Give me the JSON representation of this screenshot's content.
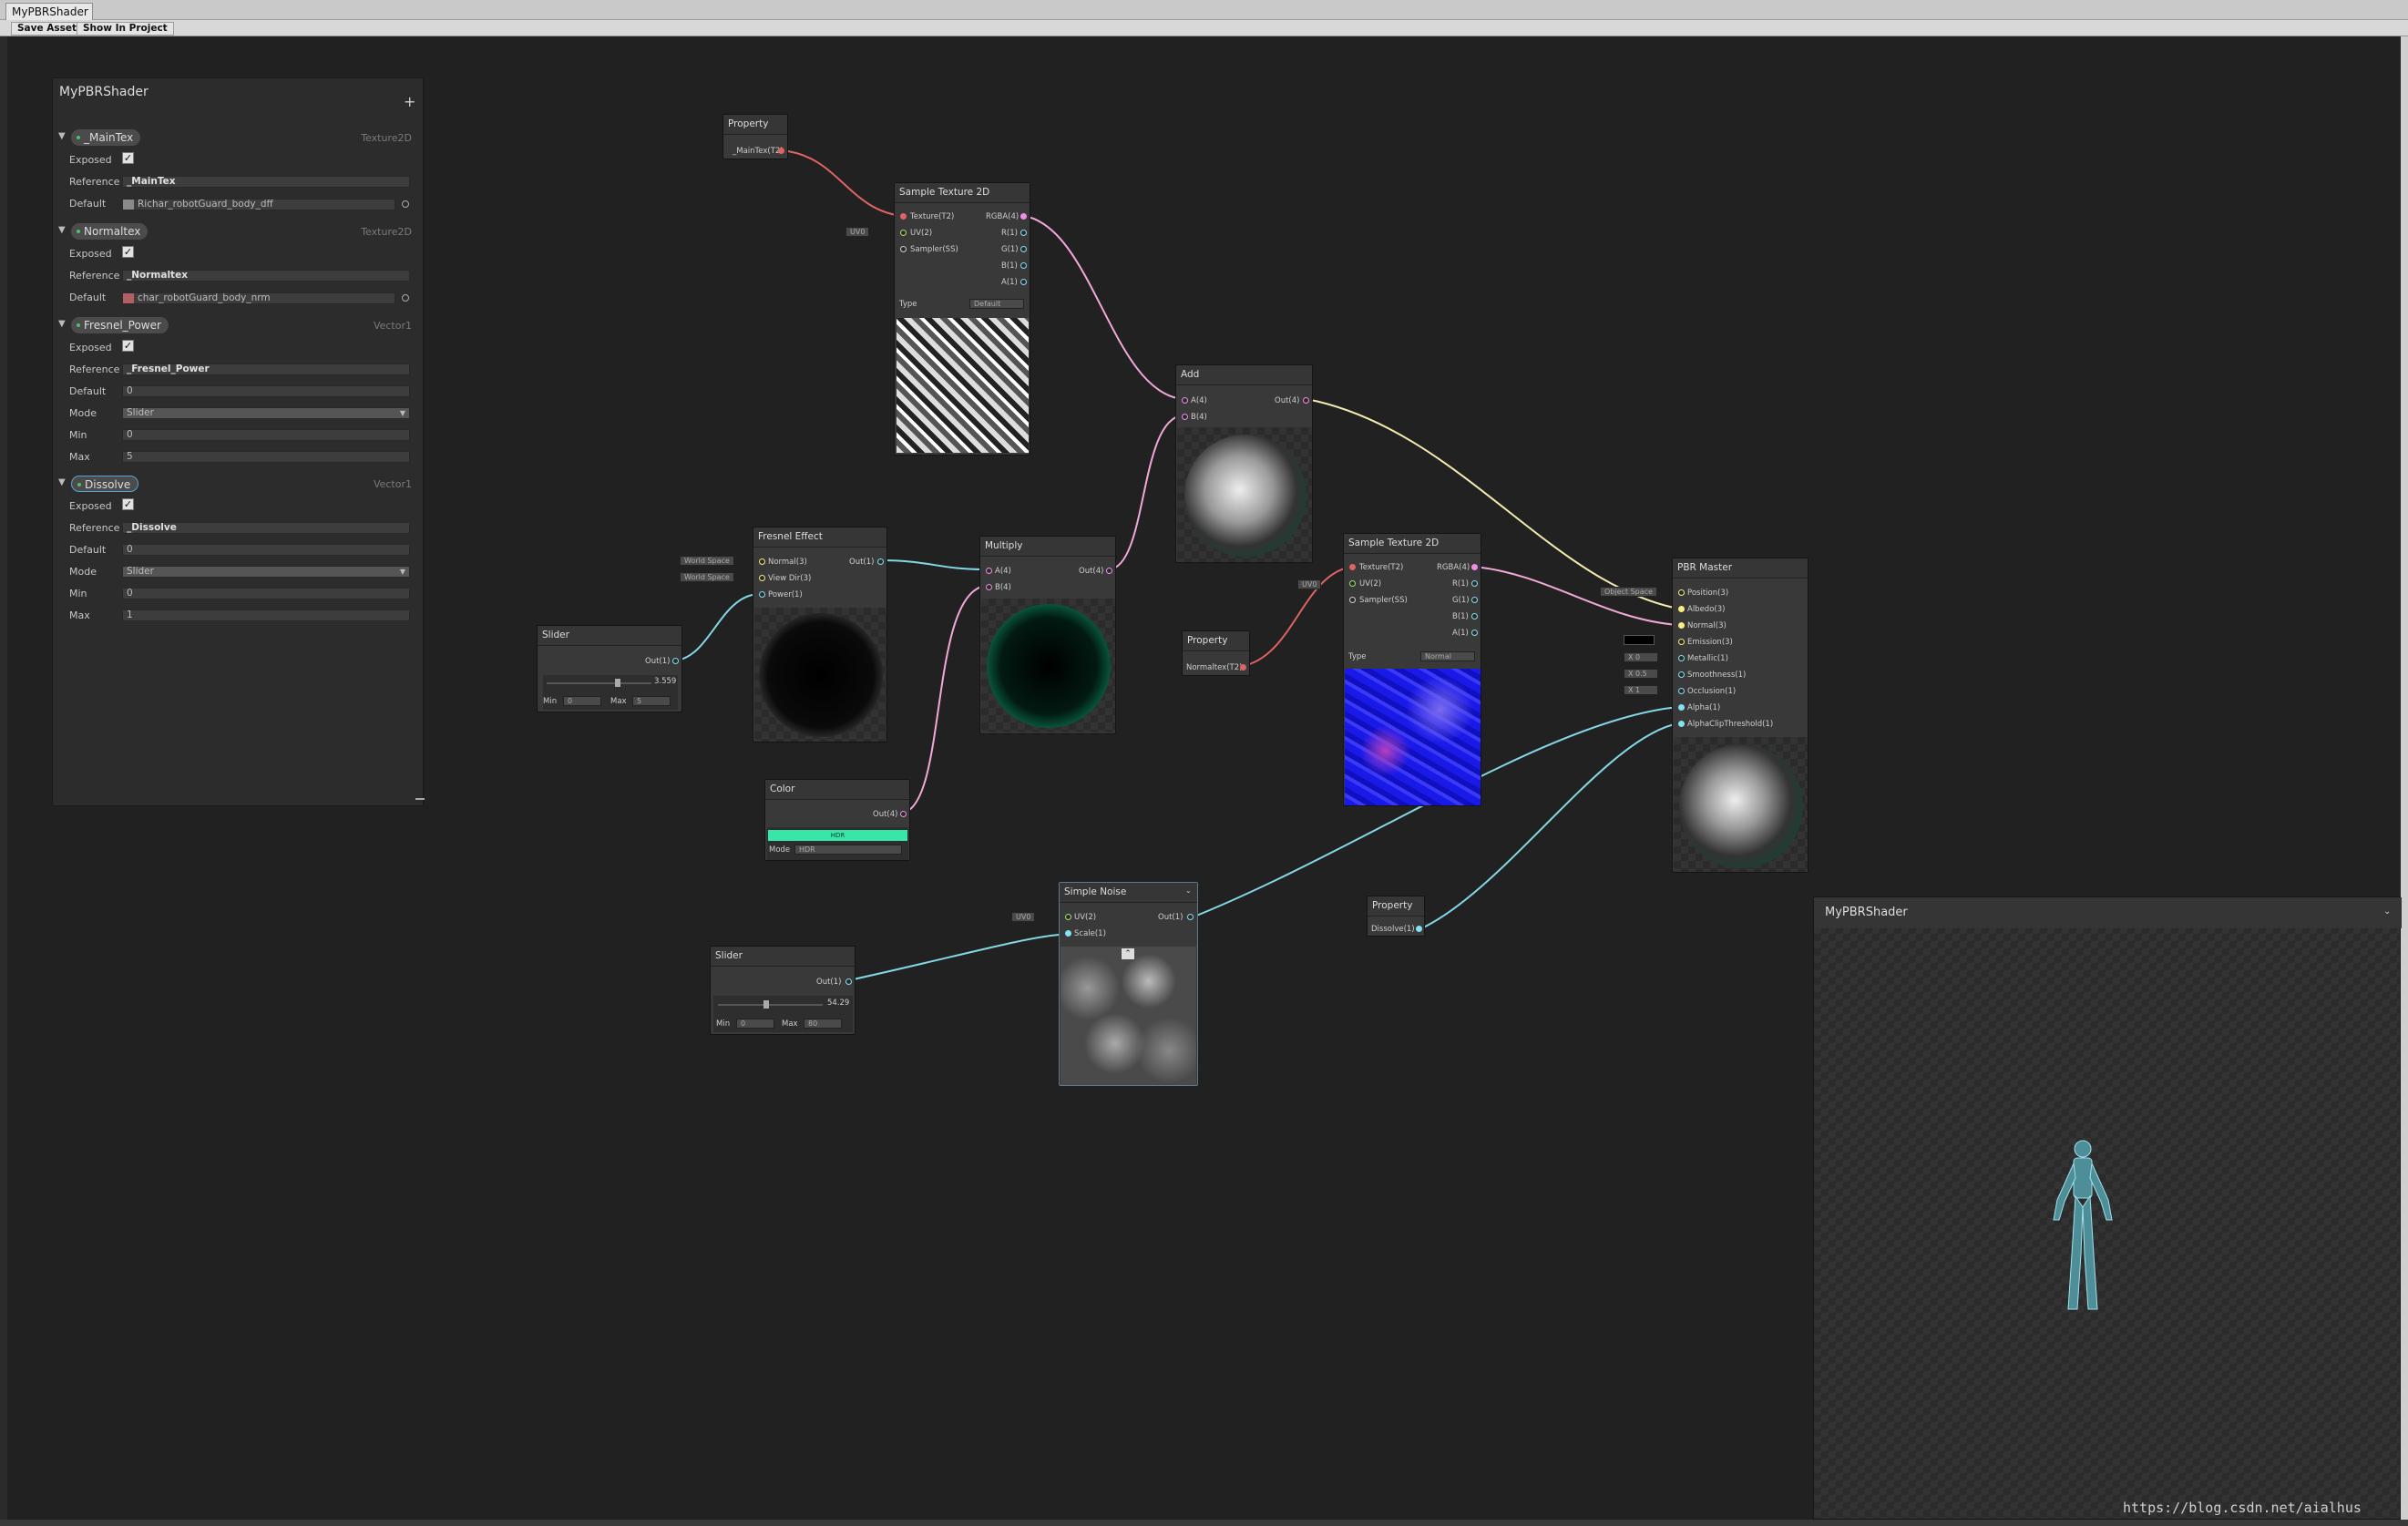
{
  "window": {
    "tab_title": "MyPBRShader",
    "save_asset": "Save Asset",
    "show_in_project": "Show In Project"
  },
  "blackboard": {
    "title": "MyPBRShader",
    "add": "+",
    "properties": [
      {
        "name": "_MainTex",
        "type": "Texture2D",
        "exposed_label": "Exposed",
        "reference_label": "Reference",
        "reference": "_MainTex",
        "default_label": "Default",
        "default": "Richar_robotGuard_body_dff"
      },
      {
        "name": "Normaltex",
        "type": "Texture2D",
        "exposed_label": "Exposed",
        "reference_label": "Reference",
        "reference": "_Normaltex",
        "default_label": "Default",
        "default": "char_robotGuard_body_nrm"
      },
      {
        "name": "Fresnel_Power",
        "type": "Vector1",
        "exposed_label": "Exposed",
        "reference_label": "Reference",
        "reference": "_Fresnel_Power",
        "default_label": "Default",
        "default": "0",
        "mode_label": "Mode",
        "mode": "Slider",
        "min_label": "Min",
        "min": "0",
        "max_label": "Max",
        "max": "5"
      },
      {
        "name": "Dissolve",
        "type": "Vector1",
        "exposed_label": "Exposed",
        "reference_label": "Reference",
        "reference": "_Dissolve",
        "default_label": "Default",
        "default": "0",
        "mode_label": "Mode",
        "mode": "Slider",
        "min_label": "Min",
        "min": "0",
        "max_label": "Max",
        "max": "1"
      }
    ]
  },
  "nodes": {
    "prop_maintex": {
      "title": "Property",
      "out": "_MainTex(T2)"
    },
    "sample1": {
      "title": "Sample Texture 2D",
      "in": [
        "Texture(T2)",
        "UV(2)",
        "Sampler(SS)"
      ],
      "out": [
        "RGBA(4)",
        "R(1)",
        "G(1)",
        "B(1)",
        "A(1)"
      ],
      "uv_tag": "UV0",
      "type_label": "Type",
      "type_value": "Default"
    },
    "add": {
      "title": "Add",
      "in": [
        "A(4)",
        "B(4)"
      ],
      "out": "Out(4)"
    },
    "fresnel": {
      "title": "Fresnel Effect",
      "in": [
        "Normal(3)",
        "View Dir(3)",
        "Power(1)"
      ],
      "out": "Out(1)",
      "tag1": "World Space",
      "tag2": "World Space"
    },
    "multiply": {
      "title": "Multiply",
      "in": [
        "A(4)",
        "B(4)"
      ],
      "out": "Out(4)"
    },
    "slider1": {
      "title": "Slider",
      "out": "Out(1)",
      "value": "3.559",
      "min_label": "Min",
      "min": "0",
      "max_label": "Max",
      "max": "5"
    },
    "color": {
      "title": "Color",
      "out": "Out(4)",
      "swatch": "#38e6a8",
      "hdr": "HDR",
      "mode_label": "Mode",
      "mode": "HDR"
    },
    "prop_normal": {
      "title": "Property",
      "out": "Normaltex(T2)"
    },
    "sample2": {
      "title": "Sample Texture 2D",
      "in": [
        "Texture(T2)",
        "UV(2)",
        "Sampler(SS)"
      ],
      "out": [
        "RGBA(4)",
        "R(1)",
        "G(1)",
        "B(1)",
        "A(1)"
      ],
      "uv_tag": "UV0",
      "type_label": "Type",
      "type_value": "Normal"
    },
    "master": {
      "title": "PBR Master",
      "in": [
        "Position(3)",
        "Albedo(3)",
        "Normal(3)",
        "Emission(3)",
        "Metallic(1)",
        "Smoothness(1)",
        "Occlusion(1)",
        "Alpha(1)",
        "AlphaClipThreshold(1)"
      ],
      "object_space": "Object Space",
      "metallic_val": "X 0",
      "smooth_val": "X 0.5",
      "occl_val": "X 1"
    },
    "noise": {
      "title": "Simple Noise",
      "in": [
        "UV(2)",
        "Scale(1)"
      ],
      "out": "Out(1)",
      "uv_tag": "UV0"
    },
    "slider2": {
      "title": "Slider",
      "out": "Out(1)",
      "value": "54.29",
      "min_label": "Min",
      "min": "0",
      "max_label": "Max",
      "max": "80"
    },
    "prop_dissolve": {
      "title": "Property",
      "out": "Dissolve(1)"
    }
  },
  "main_preview": {
    "title": "MyPBRShader"
  },
  "watermark": "https://blog.csdn.net/aialhus",
  "colors": {
    "edge_tex": "#e06464",
    "edge_v4": "#f2a8d8",
    "edge_v1": "#84d7e6",
    "edge_v3": "#f4ecb0",
    "emission": "#38e6a8"
  }
}
